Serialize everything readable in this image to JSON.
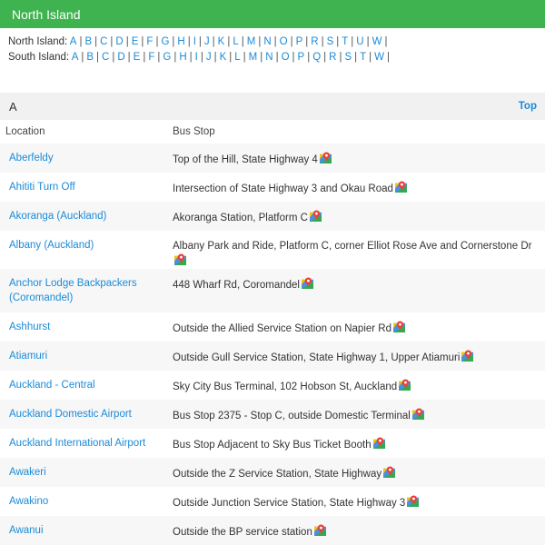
{
  "header": {
    "title": "North Island"
  },
  "index": {
    "north_label": "North Island:",
    "north_letters": [
      "A",
      "B",
      "C",
      "D",
      "E",
      "F",
      "G",
      "H",
      "I",
      "J",
      "K",
      "L",
      "M",
      "N",
      "O",
      "P",
      "R",
      "S",
      "T",
      "U",
      "W"
    ],
    "south_label": "South Island:",
    "south_letters": [
      "A",
      "B",
      "C",
      "D",
      "E",
      "F",
      "G",
      "H",
      "I",
      "J",
      "K",
      "L",
      "M",
      "N",
      "O",
      "P",
      "Q",
      "R",
      "S",
      "T",
      "W"
    ]
  },
  "section": {
    "letter": "A",
    "top_link": "Top"
  },
  "table": {
    "col_location": "Location",
    "col_stop": "Bus Stop",
    "rows": [
      {
        "location": "Aberfeldy",
        "stop": "Top of the Hill, State Highway 4"
      },
      {
        "location": "Ahititi Turn Off",
        "stop": "Intersection of State Highway 3 and Okau Road"
      },
      {
        "location": "Akoranga (Auckland)",
        "stop": "Akoranga Station, Platform C"
      },
      {
        "location": "Albany (Auckland)",
        "stop": "Albany Park and Ride, Platform C, corner Elliot Rose Ave and Cornerstone Dr"
      },
      {
        "location": "Anchor Lodge Backpackers (Coromandel)",
        "stop": "448 Wharf Rd, Coromandel"
      },
      {
        "location": "Ashhurst",
        "stop": "Outside the Allied Service Station on Napier Rd"
      },
      {
        "location": "Atiamuri",
        "stop": "Outside Gull Service Station, State Highway 1, Upper Atiamuri"
      },
      {
        "location": "Auckland - Central",
        "stop": "Sky City Bus Terminal, 102 Hobson St, Auckland"
      },
      {
        "location": "Auckland Domestic Airport",
        "stop": "Bus Stop 2375 - Stop C, outside Domestic Terminal"
      },
      {
        "location": "Auckland International Airport",
        "stop": "Bus Stop Adjacent to Sky Bus Ticket Booth"
      },
      {
        "location": "Awakeri",
        "stop": "Outside the Z Service Station, State Highway"
      },
      {
        "location": "Awakino",
        "stop": "Outside Junction Service Station, State Highway 3"
      },
      {
        "location": "Awanui",
        "stop": "Outside the BP service station"
      }
    ]
  },
  "colors": {
    "header_bg": "#3fb34f",
    "link": "#1a8bd8",
    "row_alt": "#f7f7f7"
  }
}
